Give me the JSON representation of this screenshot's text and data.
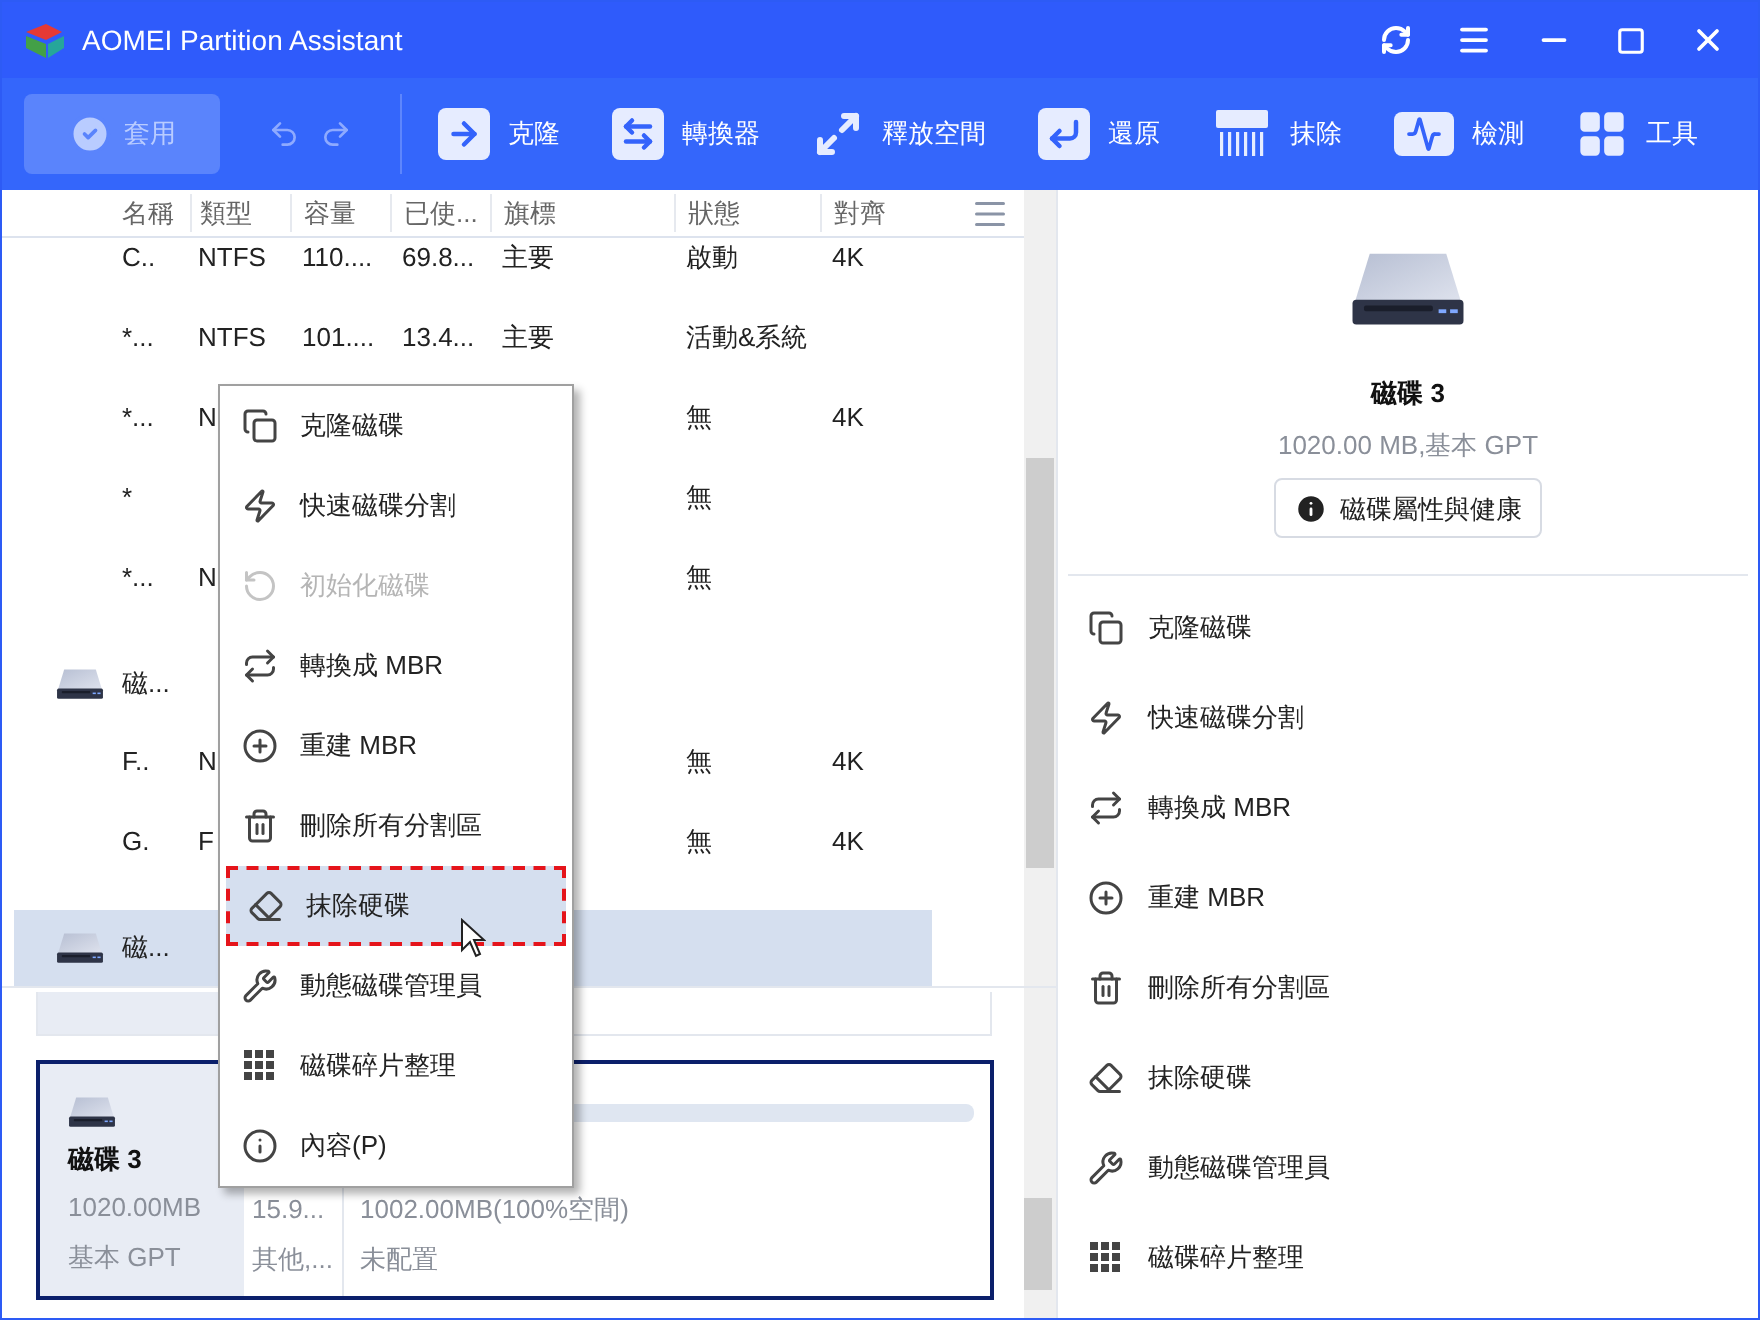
{
  "window": {
    "title": "AOMEI Partition Assistant"
  },
  "toolbar": {
    "apply": {
      "label": "套用",
      "disabled": true
    },
    "tools": [
      {
        "label": "克隆"
      },
      {
        "label": "轉換器"
      },
      {
        "label": "釋放空間"
      },
      {
        "label": "還原"
      },
      {
        "label": "抹除"
      },
      {
        "label": "檢測"
      },
      {
        "label": "工具"
      }
    ]
  },
  "table": {
    "columns": [
      {
        "label": "名稱"
      },
      {
        "label": "類型"
      },
      {
        "label": "容量"
      },
      {
        "label": "已使..."
      },
      {
        "label": "旗標"
      },
      {
        "label": "狀態"
      },
      {
        "label": "對齊"
      }
    ],
    "rows": [
      {
        "kind": "partition",
        "selected": false,
        "cells": {
          "name": "C..",
          "type": "NTFS",
          "capacity": "110....",
          "used": "69.8...",
          "flag": "主要",
          "status": "啟動",
          "align": "4K"
        }
      },
      {
        "kind": "partition",
        "selected": false,
        "cells": {
          "name": "*...",
          "type": "NTFS",
          "capacity": "101....",
          "used": "13.4...",
          "flag": "主要",
          "status": "活動&系統"
        }
      },
      {
        "kind": "partition",
        "selected": false,
        "cells": {
          "name": "*...",
          "type": "N",
          "status": "無",
          "align": "4K"
        }
      },
      {
        "kind": "partition",
        "selected": false,
        "cells": {
          "name": "*",
          "status": "無"
        }
      },
      {
        "kind": "partition",
        "selected": false,
        "cells": {
          "name": "*...",
          "type": "N",
          "status": "無"
        }
      },
      {
        "kind": "disk",
        "selected": false,
        "cells": {
          "name": "磁..."
        }
      },
      {
        "kind": "partition",
        "selected": false,
        "cells": {
          "name": "F..",
          "type": "N",
          "status": "無",
          "align": "4K"
        }
      },
      {
        "kind": "partition",
        "selected": false,
        "cells": {
          "name": "G.",
          "type": "F",
          "status": "無",
          "align": "4K"
        }
      },
      {
        "kind": "disk",
        "selected": true,
        "cells": {
          "name": "磁..."
        }
      }
    ]
  },
  "context_menu": {
    "items": [
      {
        "label": "克隆磁碟",
        "disabled": false,
        "selected": false
      },
      {
        "label": "快速磁碟分割",
        "disabled": false,
        "selected": false
      },
      {
        "label": "初始化磁碟",
        "disabled": true,
        "selected": false
      },
      {
        "label": "轉換成 MBR",
        "disabled": false,
        "selected": false
      },
      {
        "label": "重建 MBR",
        "disabled": false,
        "selected": false
      },
      {
        "label": "刪除所有分割區",
        "disabled": false,
        "selected": false
      },
      {
        "label": "抹除硬碟",
        "disabled": false,
        "selected": true
      },
      {
        "label": "動態磁碟管理員",
        "disabled": false,
        "selected": false
      },
      {
        "label": "磁碟碎片整理",
        "disabled": false,
        "selected": false
      },
      {
        "label": "內容(P)",
        "disabled": false,
        "selected": false
      }
    ]
  },
  "disk_map": {
    "disk": {
      "name": "磁碟 3",
      "size": "1020.00MB",
      "type": "基本 GPT",
      "selected": true
    },
    "partitions": [
      {
        "size": "15.9...",
        "type": "其他,..."
      },
      {
        "size": "1002.00MB(100%空間)",
        "type": "未配置"
      }
    ]
  },
  "details": {
    "name": "磁碟 3",
    "summary": "1020.00 MB,基本 GPT",
    "button": "磁碟屬性與健康",
    "operations": [
      "克隆磁碟",
      "快速磁碟分割",
      "轉換成 MBR",
      "重建 MBR",
      "刪除所有分割區",
      "抹除硬碟",
      "動態磁碟管理員",
      "磁碟碎片整理"
    ]
  }
}
